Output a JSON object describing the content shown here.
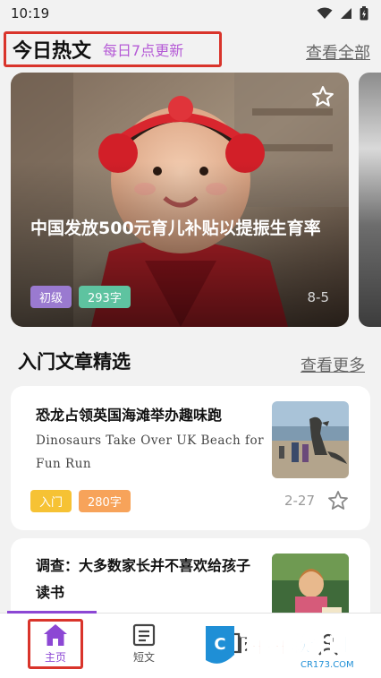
{
  "status_bar": {
    "time": "10:19"
  },
  "hot": {
    "title": "今日热文",
    "subtitle": "每日7点更新",
    "view_all": "查看全部",
    "featured": {
      "title": "中国发放500元育儿补贴以提振生育率",
      "level": "初级",
      "word_count": "293字",
      "date": "8-5"
    }
  },
  "intro": {
    "title": "入门文章精选",
    "view_more": "查看更多",
    "articles": [
      {
        "title": "恐龙占领英国海滩举办趣味跑",
        "english": "Dinosaurs Take Over UK Beach for Fun Run",
        "level": "入门",
        "word_count": "280字",
        "date": "2-27"
      },
      {
        "title": "调查：大多数家长并不喜欢给孩子读书"
      }
    ]
  },
  "tabs": [
    {
      "label": "主页",
      "icon": "home-icon",
      "active": true
    },
    {
      "label": "短文",
      "icon": "article-icon",
      "active": false
    },
    {
      "label": "",
      "icon": "book-icon",
      "active": false
    },
    {
      "label": "",
      "icon": "user-icon",
      "active": false
    }
  ],
  "watermark": {
    "brand": "西西",
    "name": "软件园",
    "url": "CR173.COM"
  },
  "colors": {
    "accent": "#8c47d4",
    "highlight_box": "#d9342b",
    "tag_purple": "#9a7ad0",
    "tag_green": "#5ec3a0",
    "tag_yellow": "#f6c234",
    "tag_orange": "#f7a35a"
  }
}
